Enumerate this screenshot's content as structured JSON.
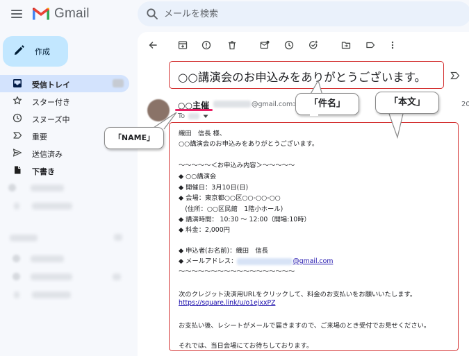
{
  "app": {
    "logo_text": "Gmail",
    "search_placeholder": "メールを検索"
  },
  "sidebar": {
    "compose_label": "作成",
    "items": [
      {
        "label": "受信トレイ",
        "icon": "inbox-icon",
        "active": true
      },
      {
        "label": "スター付き",
        "icon": "star-icon"
      },
      {
        "label": "スヌーズ中",
        "icon": "clock-icon"
      },
      {
        "label": "重要",
        "icon": "important-icon"
      },
      {
        "label": "送信済み",
        "icon": "send-icon"
      },
      {
        "label": "下書き",
        "icon": "draft-icon",
        "bold": true
      }
    ]
  },
  "toolbar": {
    "icons": [
      "back-arrow-icon",
      "archive-icon",
      "report-spam-icon",
      "delete-icon",
      "mark-unread-icon",
      "snooze-icon",
      "add-task-icon",
      "move-to-icon",
      "label-icon",
      "more-vert-icon"
    ]
  },
  "email": {
    "subject": "○○講演会のお申込みをありがとうございます。",
    "sender_name": "○○主催",
    "sender_email": "@gmail.com>",
    "to_label": "To",
    "date_partial": "20",
    "body": {
      "greeting": "織田　信長 様、",
      "thanks": "○○講演会のお申込みをありがとうございます。",
      "divider_top": "～～～～～＜お申込み内容＞～～～～～",
      "details": [
        "◆ ○○講演会",
        "◆ 開催日：3月10日(日)",
        "◆ 会場：東京都○○区○○-○○-○○",
        "　(住所：○○区民館　1階小ホール)",
        "◆ 講演時間： 10:30 ～ 12:00（開場:10時）",
        "◆ 料金：2,000円"
      ],
      "applicant": "◆ 申込者(お名前)：織田　信長",
      "email_label": "◆ メールアドレス：",
      "email_domain": "@gmail.com",
      "divider_bottom": "～～～～～～～～～～～～～～～～～～",
      "payment_text": "次のクレジット決済用URLをクリックして、料金のお支払いをお願いいたします。",
      "payment_link": "https://square.link/u/o1ejxxPZ",
      "receipt_text": "お支払い後、レシートがメールで届きますので、ご来場のとき受付でお見せください。",
      "closing": "それでは、当日会場にてお待ちしております。"
    }
  },
  "callouts": {
    "subject": "「件名」",
    "body": "「本文」",
    "name": "「NAME」"
  },
  "colors": {
    "highlight_border": "#d32f2f",
    "name_underline": "#e91e63",
    "compose_bg": "#c2e7ff",
    "active_nav_bg": "#d3e3fd"
  }
}
